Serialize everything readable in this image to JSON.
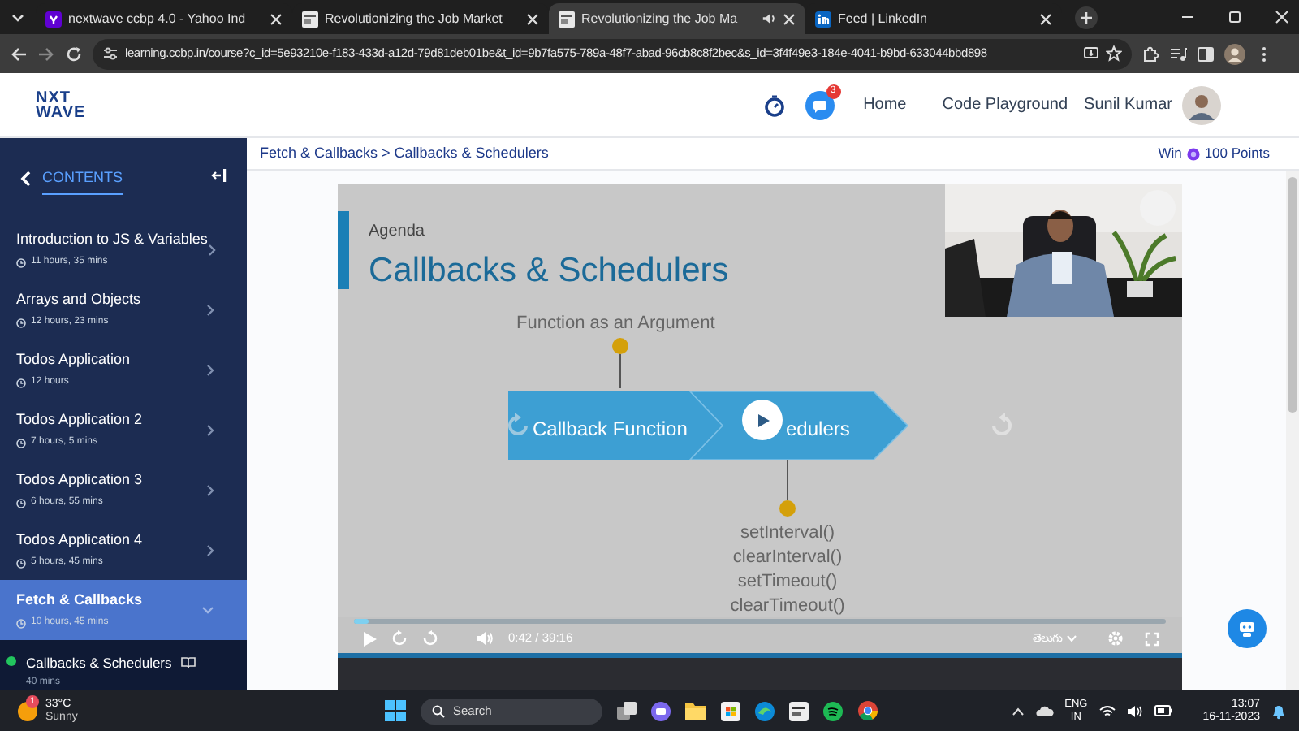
{
  "browser": {
    "tabs": [
      {
        "kind": "yahoo",
        "title": "nextwave ccbp 4.0 - Yahoo Ind",
        "selected": false,
        "audio": false
      },
      {
        "kind": "page",
        "title": "Revolutionizing the Job Market",
        "selected": false,
        "audio": false
      },
      {
        "kind": "page",
        "title": "Revolutionizing the Job Ma",
        "selected": true,
        "audio": true
      },
      {
        "kind": "linkedin",
        "title": "Feed | LinkedIn",
        "selected": false,
        "audio": false
      }
    ],
    "url": "learning.ccbp.in/course?c_id=5e93210e-f183-433d-a12d-79d81deb01be&t_id=9b7fa575-789a-48f7-abad-96cb8c8f2bec&s_id=3f4f49e3-184e-4041-b9bd-633044bbd898"
  },
  "header": {
    "logo": [
      "NXT",
      "WAVE"
    ],
    "notification_count": "3",
    "nav": [
      "Home",
      "Code Playground"
    ],
    "user": "Sunil Kumar"
  },
  "breadcrumb": "Fetch & Callbacks > Callbacks & Schedulers",
  "points": {
    "prefix": "Win",
    "value": "100 Points"
  },
  "sidebar": {
    "title": "CONTENTS",
    "items": [
      {
        "title": "Introduction to JS & Variables",
        "duration": "11 hours, 35 mins",
        "selected": false,
        "expanded": false
      },
      {
        "title": "Arrays and Objects",
        "duration": "12 hours, 23 mins",
        "selected": false,
        "expanded": false
      },
      {
        "title": "Todos Application",
        "duration": "12 hours",
        "selected": false,
        "expanded": false
      },
      {
        "title": "Todos Application 2",
        "duration": "7 hours, 5 mins",
        "selected": false,
        "expanded": false
      },
      {
        "title": "Todos Application 3",
        "duration": "6 hours, 55 mins",
        "selected": false,
        "expanded": false
      },
      {
        "title": "Todos Application 4",
        "duration": "5 hours, 45 mins",
        "selected": false,
        "expanded": false
      },
      {
        "title": "Fetch & Callbacks",
        "duration": "10 hours, 45 mins",
        "selected": true,
        "expanded": true
      }
    ],
    "sub_items": [
      {
        "title": "Callbacks & Schedulers",
        "duration": "40 mins",
        "completed": true
      }
    ]
  },
  "video": {
    "slide": {
      "subtitle": "Agenda",
      "title": "Callbacks & Schedulers",
      "top_label": "Function as an Argument",
      "nodes": [
        "Callback Function",
        "edulers"
      ],
      "functions": [
        "setInterval()",
        "clearInterval()",
        "setTimeout()",
        "clearTimeout()"
      ]
    },
    "player": {
      "level": 0.018,
      "time": "0:42 / 39:16",
      "language": "తెలుగు"
    }
  },
  "taskbar": {
    "temperature": "33°C",
    "condition": "Sunny",
    "weather_badge": "1",
    "search": "Search",
    "language": [
      "ENG",
      "IN"
    ],
    "time": "13:07",
    "date": "16-11-2023"
  }
}
